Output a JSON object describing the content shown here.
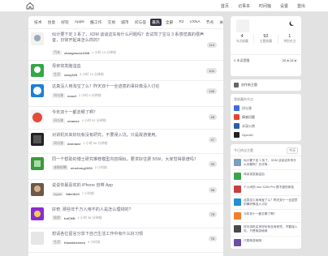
{
  "header": {
    "nav": [
      "首页",
      "记事本",
      "时间轴",
      "设置",
      "登出"
    ]
  },
  "tabs": [
    "技术",
    "创意",
    "好玩",
    "Apple",
    "酷工作",
    "交易",
    "城市",
    "问与答",
    "最热",
    "全部",
    "R2",
    "VXNA",
    "节点",
    "关注"
  ],
  "topics": [
    {
      "title": "似计要下定 3 系了，XDM 谈谈这车有什么问题吗？去试驾了宝马 3 系感觉真的很声音，日常开起来怎么样的？",
      "node": "汽车",
      "user": "zhangmuen1008",
      "time": "1 小时 10 分钟前",
      "count": "119"
    },
    {
      "title": "母亲突发脑溢血",
      "node": "生活",
      "user": "xtmy929",
      "time": "3 小时 10 分钟前",
      "count": "104"
    },
    {
      "title": "这真没人用淘宝了么？昨天双十一全迹意的事好像没人讨论",
      "node": "问与答",
      "user": "xuuuf",
      "time": "2 小时 5 分钟前",
      "count": "136"
    },
    {
      "title": "今年双十一都去哪了啊？",
      "node": "问与答",
      "user": "vmasse",
      "time": "1 小时 52 分钟前",
      "count": "28"
    },
    {
      "title": "对讲机买来好玩有没有研究，不要误入坑。只是故游使用。",
      "node": "问与答",
      "user": "donnaxe",
      "time": "1 小时 50 分钟前",
      "count": "37"
    },
    {
      "title": "同一个帮助的博士研究推荐模型内容相似，要求好住费 50W，大家觉得靠谱吗？",
      "node": "求职招聘",
      "user": "sinchong1093",
      "time": "2 小时前",
      "count": "39"
    },
    {
      "title": "说说你最喜欢的 iPhone 自带 App",
      "node": "Apple",
      "user": "fabethell",
      "time": "7 小时前",
      "count": "98"
    },
    {
      "title": "好奇, 那些年千万人用不的人是怎么理财的?",
      "node": "投资",
      "user": "tuiCHN",
      "time": "1 小时 38 分钟前",
      "count": "78"
    },
    {
      "title": "想请各位留言分享下自己生活工作中有什么好习惯",
      "node": "生活",
      "user": "frisatshensen",
      "time": "3 小时前",
      "count": "76"
    }
  ],
  "profile": {
    "stats": [
      {
        "n": "4",
        "l": "节点收藏"
      },
      {
        "n": "92",
        "l": "主题收藏"
      },
      {
        "n": "1",
        "l": "特别关注"
      }
    ],
    "balance_label": "0 未读提醒",
    "balance": "20 ● 14 ●"
  },
  "create_label": "创作新主题",
  "favorite_nodes_title": "我收藏的节点",
  "favorite_nodes": [
    {
      "name": "问与答",
      "color": "#3a6fd8"
    },
    {
      "name": "情感问题",
      "color": "#e0452f"
    },
    {
      "name": "水深火热",
      "color": "#2a5fa8"
    },
    {
      "name": "OpenAI",
      "color": "#222222"
    }
  ],
  "hot_title": "今日热议主题",
  "hot_button": "今天",
  "hot_topics": [
    {
      "text": "似计要下定 3 系了，XDM 谈谈这车有什么问题吗？去试驾...",
      "color": "#7a9ec2"
    },
    {
      "text": "母亲突发脑溢血",
      "color": "#3aa44a"
    },
    {
      "text": "个人间的 vivo X200 Pro 很不错的体验",
      "color": "#c93f3f"
    },
    {
      "text": "这真没人用淘宝了么？昨天双十一全迹意的事好像没人讨论",
      "color": "#1f8fd6"
    },
    {
      "text": "今年双十一都去哪了啊？",
      "color": "#f07f2a"
    },
    {
      "text": "好对讲机买来好玩有没有研究，不要误入坑。只是故游使用",
      "color": "#4a4a4a"
    },
    {
      "text": "只是故游使用",
      "color": "#6c4da8"
    }
  ]
}
